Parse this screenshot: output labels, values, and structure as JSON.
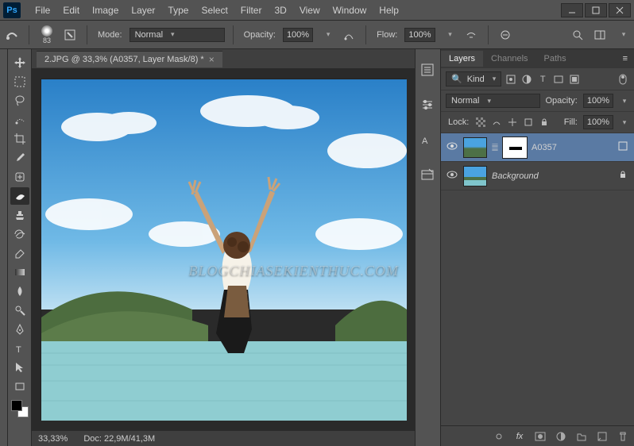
{
  "app": {
    "logo": "Ps"
  },
  "menu": [
    "File",
    "Edit",
    "Image",
    "Layer",
    "Type",
    "Select",
    "Filter",
    "3D",
    "View",
    "Window",
    "Help"
  ],
  "options": {
    "brush_size": "83",
    "mode_label": "Mode:",
    "mode_value": "Normal",
    "opacity_label": "Opacity:",
    "opacity_value": "100%",
    "flow_label": "Flow:",
    "flow_value": "100%"
  },
  "document": {
    "tab_title": "2.JPG @ 33,3% (A0357, Layer Mask/8) *",
    "zoom": "33,33%",
    "doc_label": "Doc:",
    "doc_size": "22,9M/41,3M",
    "watermark": "BLOGCHIASEKIENTHUC.COM"
  },
  "panels": {
    "tabs": {
      "layers": "Layers",
      "channels": "Channels",
      "paths": "Paths"
    },
    "filter": {
      "kind_label": "Kind"
    },
    "blend": {
      "mode": "Normal",
      "opacity_label": "Opacity:",
      "opacity_value": "100%"
    },
    "lock": {
      "label": "Lock:",
      "fill_label": "Fill:",
      "fill_value": "100%"
    }
  },
  "layers": [
    {
      "name": "A0357",
      "has_mask": true,
      "italic": false,
      "selected": true
    },
    {
      "name": "Background",
      "has_mask": false,
      "italic": true,
      "selected": false,
      "locked": true
    }
  ]
}
